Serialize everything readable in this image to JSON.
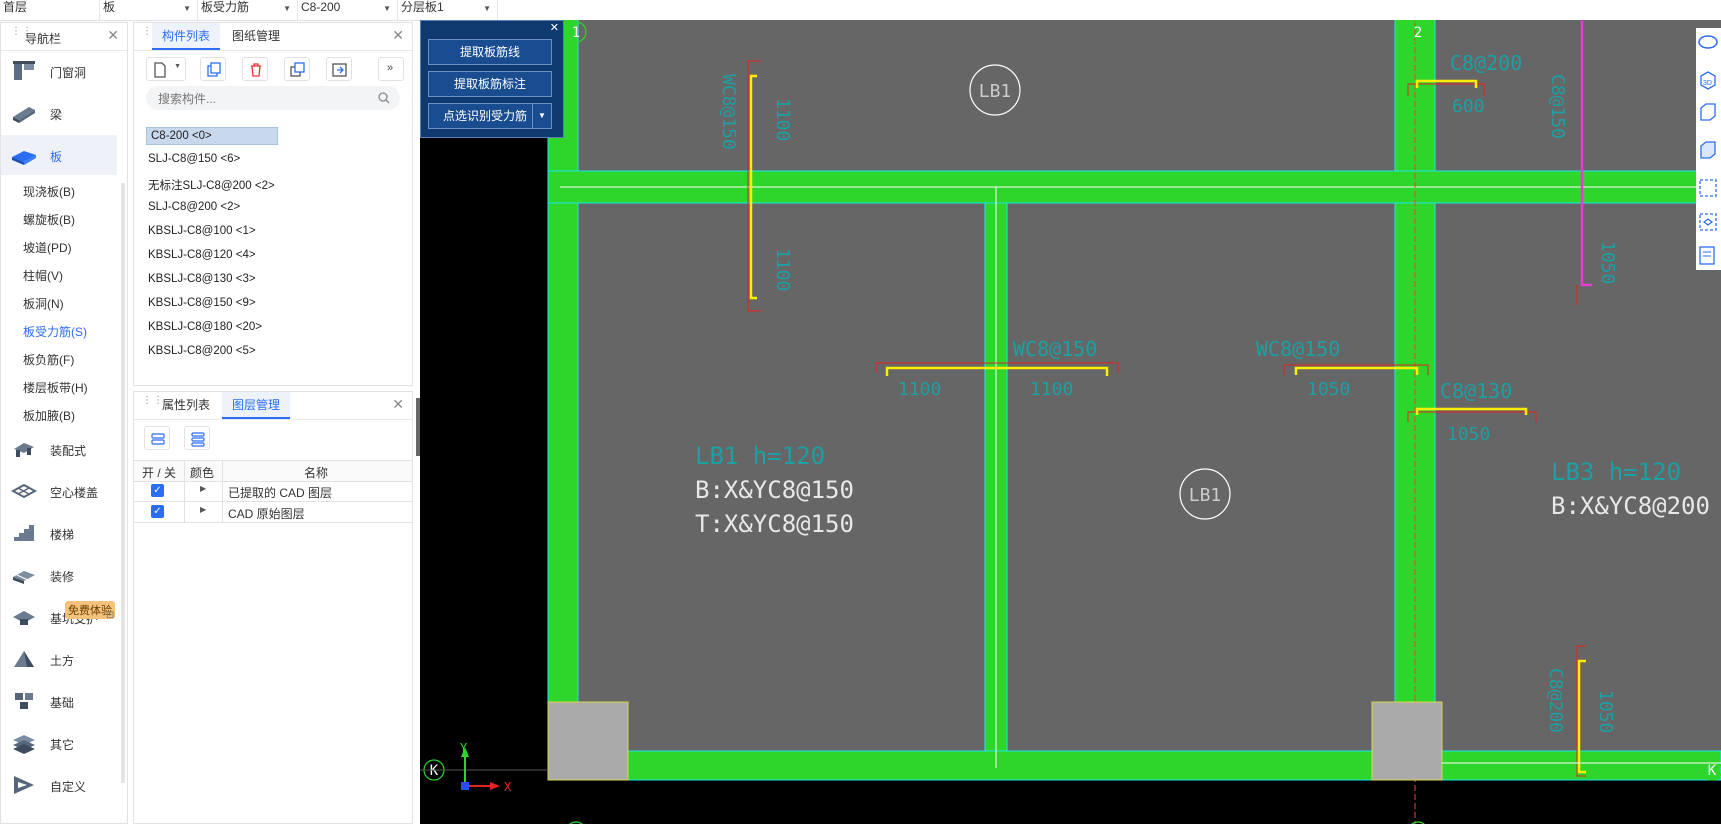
{
  "topbar": {
    "floor": "首层",
    "component_type": "板",
    "component_sub": "板受力筋",
    "component_name": "C8-200",
    "layer_plate": "分层板1"
  },
  "nav": {
    "title": "导航栏",
    "items_top": [
      {
        "label": "门窗洞",
        "icon": "door-window-icon"
      },
      {
        "label": "梁",
        "icon": "beam-icon"
      },
      {
        "label": "板",
        "icon": "slab-icon"
      }
    ],
    "sub_items": [
      "现浇板(B)",
      "螺旋板(B)",
      "坡道(PD)",
      "柱帽(V)",
      "板洞(N)",
      "板受力筋(S)",
      "板负筋(F)",
      "楼层板带(H)",
      "板加腋(B)"
    ],
    "active_sub": "板受力筋(S)",
    "items_bottom": [
      {
        "label": "装配式",
        "icon": "prefab-icon"
      },
      {
        "label": "空心楼盖",
        "icon": "hollow-floor-icon"
      },
      {
        "label": "楼梯",
        "icon": "stairs-icon"
      },
      {
        "label": "装修",
        "icon": "decoration-icon"
      },
      {
        "label": "基坑支护",
        "icon": "pit-support-icon"
      },
      {
        "label": "土方",
        "icon": "earthwork-icon"
      },
      {
        "label": "基础",
        "icon": "foundation-icon"
      },
      {
        "label": "其它",
        "icon": "other-icon"
      },
      {
        "label": "自定义",
        "icon": "custom-icon"
      }
    ],
    "free_trial_badge": "免费体验"
  },
  "component_panel": {
    "tabs": [
      "构件列表",
      "图纸管理"
    ],
    "search_placeholder": "搜索构件...",
    "items": [
      "C8-200 <0>",
      "SLJ-C8@150 <6>",
      "无标注SLJ-C8@200 <2>",
      "SLJ-C8@200 <2>",
      "KBSLJ-C8@100 <1>",
      "KBSLJ-C8@120 <4>",
      "KBSLJ-C8@130 <3>",
      "KBSLJ-C8@150 <9>",
      "KBSLJ-C8@180 <20>",
      "KBSLJ-C8@200 <5>"
    ]
  },
  "layer_panel": {
    "tabs": [
      "属性列表",
      "图层管理"
    ],
    "columns": [
      "开 / 关",
      "颜色",
      "名称"
    ],
    "rows": [
      {
        "checked": true,
        "name": "已提取的 CAD 图层"
      },
      {
        "checked": true,
        "name": "CAD 原始图层"
      }
    ]
  },
  "float_panel": {
    "buttons": [
      "提取板筋线",
      "提取板筋标注",
      "点选识别受力筋"
    ]
  },
  "cad": {
    "axis_labels": [
      "1",
      "2",
      "K"
    ],
    "slab_labels": {
      "lb1_circle": "LB1",
      "lb1_title": "LB1  h=120",
      "lb1_bottom": "B:X&YC8@150",
      "lb1_top": "T:X&YC8@150",
      "lb3_title": "LB3  h=120",
      "lb3_bottom": "B:X&YC8@200"
    },
    "rebar_labels": {
      "v1_top": "1100",
      "v1_bottom": "1100",
      "v1_name": "WC8@150",
      "h1_name": "WC8@150",
      "h1_left": "1100",
      "h1_right": "1100",
      "h2_name": "WC8@150",
      "h2_left": "1050",
      "r1_name": "C8@200",
      "r1_len": "600",
      "r2_name": "C8@130",
      "r2_len": "1050",
      "v2_name": "C8@150",
      "v2_len": "1050",
      "v3_name": "C8@200",
      "v3_len": "1050",
      "v4_name": "C8@150",
      "v4_len": "1100"
    },
    "ucs": {
      "x": "X",
      "y": "Y"
    }
  },
  "colors": {
    "beam_green": "#2ed52a",
    "slab_gray": "#666666",
    "rebar_yellow": "#ffee00",
    "rebar_magenta": "#e83bd3",
    "text_cyan": "#1e9fa3",
    "accent_blue": "#2b6ef5",
    "panel_navy": "#1a4d8f"
  }
}
